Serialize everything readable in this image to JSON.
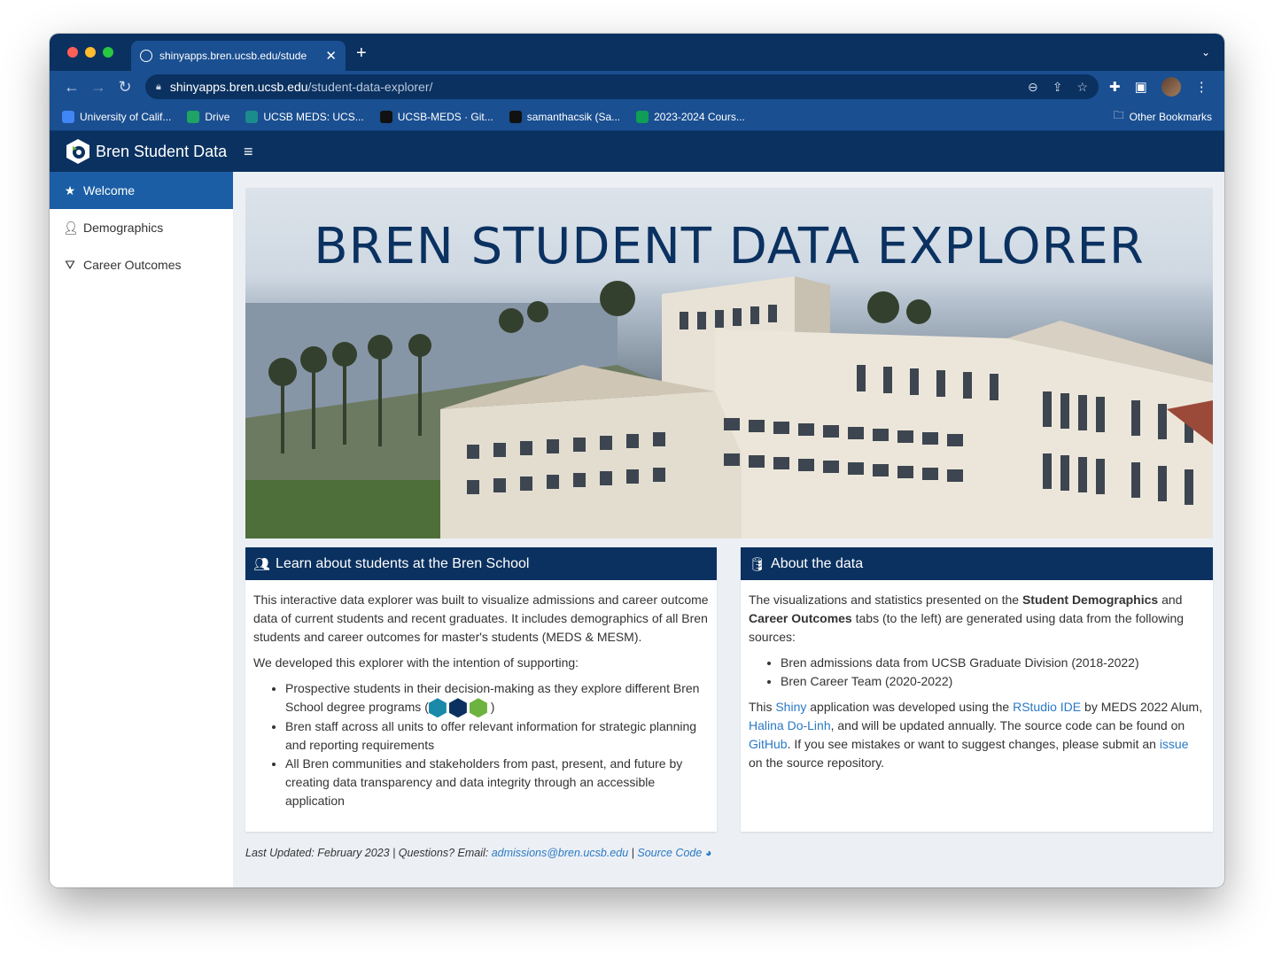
{
  "browser": {
    "tab_title": "shinyapps.bren.ucsb.edu/stude",
    "url_host": "shinyapps.bren.ucsb.edu",
    "url_path": "/student-data-explorer/",
    "bookmarks": [
      {
        "label": "University of Calif...",
        "color": "#4285f4"
      },
      {
        "label": "Drive",
        "color": "#1fa463"
      },
      {
        "label": "UCSB MEDS: UCS...",
        "color": "#1a8c8c"
      },
      {
        "label": "UCSB-MEDS · Git...",
        "color": "#111111"
      },
      {
        "label": "samanthacsik (Sa...",
        "color": "#111111"
      },
      {
        "label": "2023-2024 Cours...",
        "color": "#0f9d58"
      }
    ],
    "other_bookmarks": "Other Bookmarks"
  },
  "app": {
    "brand": "Bren Student Data",
    "nav": [
      {
        "label": "Welcome",
        "icon": "star-icon",
        "active": true
      },
      {
        "label": "Demographics",
        "icon": "user-icon",
        "active": false
      },
      {
        "label": "Career Outcomes",
        "icon": "road-icon",
        "active": false
      }
    ],
    "hero_title": "BREN STUDENT DATA EXPLORER",
    "left_box": {
      "title": "Learn about students at the Bren School",
      "p1": "This interactive data explorer was built to visualize admissions and career outcome data of current students and recent graduates. It includes demographics of all Bren students and career outcomes for master's students (MEDS & MESM).",
      "p2": "We developed this explorer with the intention of supporting:",
      "b1": "Prospective students in their decision-making as they explore different Bren School degree programs (",
      "b1_end": ")",
      "b2": "Bren staff across all units to offer relevant information for strategic planning and reporting requirements",
      "b3": "All Bren communities and stakeholders from past, present, and future by creating data transparency and data integrity through an accessible application"
    },
    "right_box": {
      "title": "About the data",
      "p1_a": "The visualizations and statistics presented on the ",
      "p1_b": "Student Demographics",
      "p1_c": " and ",
      "p1_d": "Career Outcomes",
      "p1_e": " tabs (to the left) are generated using data from the following sources:",
      "li1": "Bren admissions data from UCSB Graduate Division (2018-2022)",
      "li2": "Bren Career Team (2020-2022)",
      "p2_a": "This ",
      "p2_shiny": "Shiny",
      "p2_b": " application was developed using the ",
      "p2_rstudio": "RStudio IDE",
      "p2_c": " by MEDS 2022 Alum, ",
      "p2_halina": "Halina Do-Linh",
      "p2_d": ", and will be updated annually. The source code can be found on ",
      "p2_github": "GitHub",
      "p2_e": ". If you see mistakes or want to suggest changes, please submit an ",
      "p2_issue": "issue",
      "p2_f": " on the source repository."
    },
    "footer": {
      "text": "Last Updated: February 2023 | Questions? Email: ",
      "email": "admissions@bren.ucsb.edu",
      "sep": " | ",
      "source": "Source Code"
    }
  },
  "colors": {
    "navy": "#0a3160",
    "active_nav": "#1b5ea5",
    "link": "#2a79c5"
  }
}
